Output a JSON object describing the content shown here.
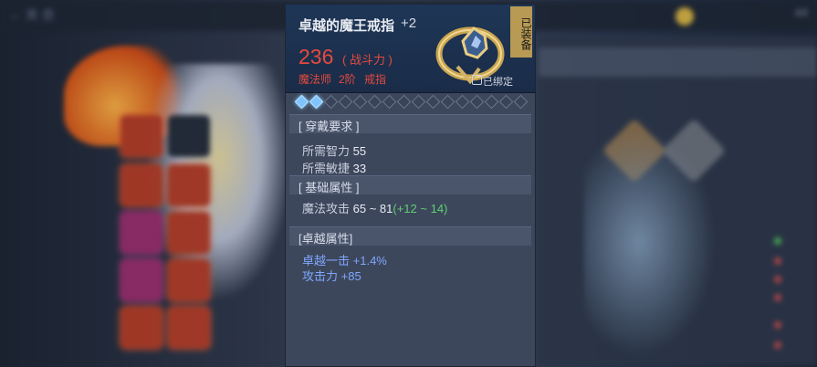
{
  "background": {
    "topbar_left_text": "← 关 合",
    "topbar_right_text": "44"
  },
  "item": {
    "name": "卓越的魔王戒指",
    "enhance": "+2",
    "power": "236",
    "power_label": "( 战斗力 )",
    "class_req": "魔法师",
    "tier": "2阶",
    "type": "戒指",
    "equipped_tag": "已装备",
    "bound_text": "已绑定",
    "gems_total": 16,
    "gems_filled": 2
  },
  "sections": {
    "wear_req": {
      "title": "[ 穿戴要求 ]",
      "lines": [
        {
          "label": "所需智力",
          "value": "55"
        },
        {
          "label": "所需敏捷",
          "value": "33"
        }
      ]
    },
    "base_attr": {
      "title": "[ 基础属性 ]",
      "lines": [
        {
          "label": "魔法攻击",
          "value": "65 ~ 81",
          "bonus": "(+12 ~ 14)"
        }
      ]
    },
    "excellent_attr": {
      "title": "[卓越属性]",
      "lines": [
        {
          "label": "卓越一击",
          "value": "+1.4%"
        },
        {
          "label": "攻击力",
          "value": "+85"
        }
      ]
    }
  },
  "colors": {
    "power_red": "#e64a3e",
    "bonus_green": "#5fcf72",
    "excellent_blue": "#7ea7ff",
    "gem_on": "#7fc4ff"
  }
}
